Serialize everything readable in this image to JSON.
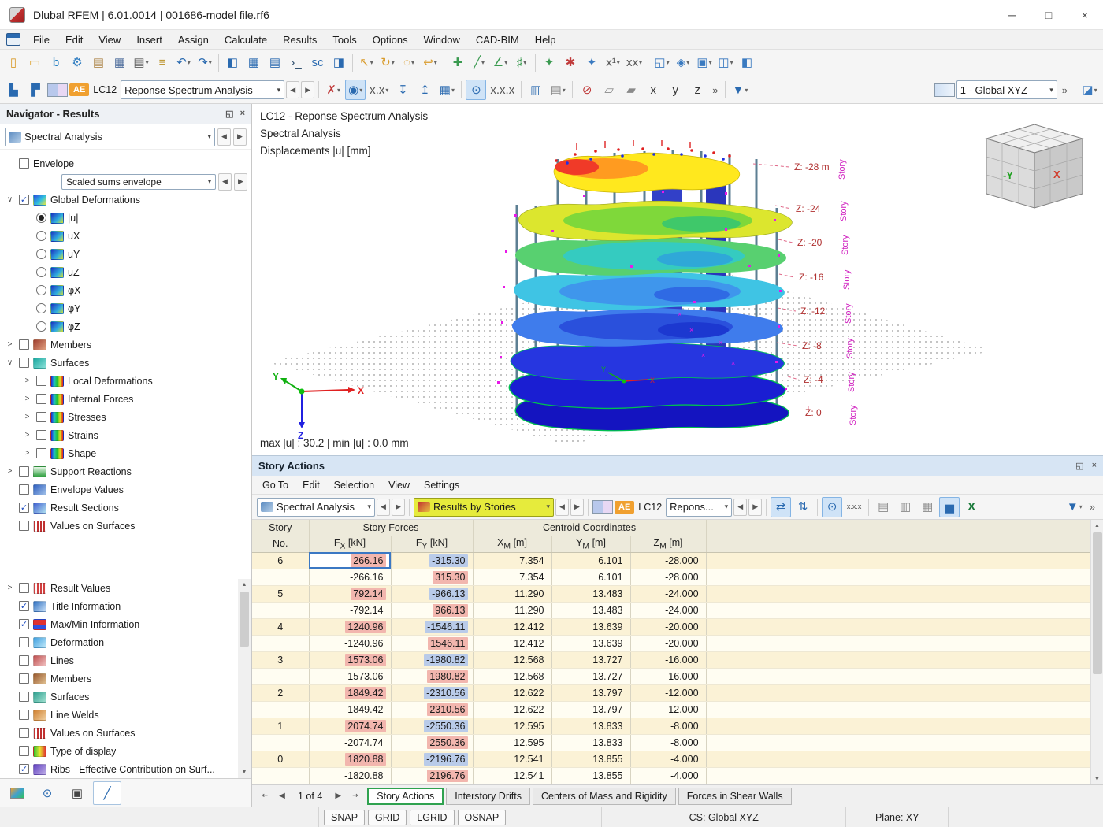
{
  "ui": {
    "dropdown": "▾",
    "left": "◀",
    "right": "▶",
    "chev_down": "∨",
    "chev_right": ">",
    "pin": "◱",
    "close": "×",
    "min": "─",
    "max": "□",
    "overflow": "»",
    "up": "▲",
    "down": "▼",
    "first": "⇤",
    "last": "⇥"
  },
  "window": {
    "title": "Dlubal RFEM | 6.01.0014 | 001686-model file.rf6"
  },
  "menu": {
    "items": [
      "File",
      "Edit",
      "View",
      "Insert",
      "Assign",
      "Calculate",
      "Results",
      "Tools",
      "Options",
      "Window",
      "CAD-BIM",
      "Help"
    ]
  },
  "toolbar1": {
    "icons": [
      {
        "name": "new-model-icon",
        "glyph": "▯",
        "color": "#d99b2b"
      },
      {
        "name": "open-file-icon",
        "glyph": "▭",
        "color": "#e0a83c"
      },
      {
        "name": "bim-link-icon",
        "glyph": "b",
        "color": "#1a7ac0"
      },
      {
        "name": "web-services-icon",
        "glyph": "⚙",
        "color": "#2a7ac0"
      },
      {
        "name": "paste-icon",
        "glyph": "▤",
        "color": "#b08a50"
      },
      {
        "name": "save-icon",
        "glyph": "▦",
        "color": "#4a6a9a"
      },
      {
        "name": "print-icon",
        "glyph": "▤",
        "color": "#5a5a5a",
        "dd": true
      },
      {
        "name": "printout-report-icon",
        "glyph": "≡",
        "color": "#c09a3a"
      },
      {
        "name": "undo-icon",
        "glyph": "↶",
        "color": "#2a6ab0",
        "dd": true
      },
      {
        "name": "redo-icon",
        "glyph": "↷",
        "color": "#2a6ab0",
        "dd": true
      },
      {
        "sep": true
      },
      {
        "name": "navigator-toggle-icon",
        "glyph": "◧",
        "color": "#2a6ab0"
      },
      {
        "name": "tables-toggle-icon",
        "glyph": "▦",
        "color": "#2a6ab0"
      },
      {
        "name": "report-icon",
        "glyph": "▤",
        "color": "#2a6ab0"
      },
      {
        "name": "script-console-icon",
        "glyph": "›_",
        "color": "#2a4a6a"
      },
      {
        "name": "to-scale-icon",
        "glyph": "sc",
        "color": "#2a6ab0"
      },
      {
        "name": "panels-icon",
        "glyph": "◨",
        "color": "#2a6ab0"
      },
      {
        "sep": true
      },
      {
        "name": "select-arrow-icon",
        "glyph": "↖",
        "color": "#d99b2b",
        "dd": true
      },
      {
        "name": "rotate-view-icon",
        "glyph": "↻",
        "color": "#d99b2b",
        "dd": true
      },
      {
        "name": "zoom-select-icon",
        "glyph": "◌",
        "color": "#d99b2b",
        "dd": true
      },
      {
        "name": "previous-view-icon",
        "glyph": "↩",
        "color": "#d99b2b",
        "dd": true
      },
      {
        "sep": true
      },
      {
        "name": "snap-node-icon",
        "glyph": "✚",
        "color": "#3a9a50"
      },
      {
        "name": "snap-line-icon",
        "glyph": "╱",
        "color": "#3a9a50",
        "dd": true
      },
      {
        "name": "snap-angle-icon",
        "glyph": "∠",
        "color": "#3a9a50",
        "dd": true
      },
      {
        "name": "guidelines-icon",
        "glyph": "♯",
        "color": "#3a9a50",
        "dd": true
      },
      {
        "sep": true
      },
      {
        "name": "generate-model-icon",
        "glyph": "✦",
        "color": "#3a9a50"
      },
      {
        "name": "generate-loads-icon",
        "glyph": "✱",
        "color": "#c03a3a"
      },
      {
        "name": "generate-combinations-icon",
        "glyph": "✦",
        "color": "#3a7ac0"
      },
      {
        "name": "numbering-icon",
        "glyph": "x¹",
        "color": "#555555",
        "dd": true
      },
      {
        "name": "renumber-icon",
        "glyph": "xx",
        "color": "#555555",
        "dd": true
      },
      {
        "sep": true
      },
      {
        "name": "new-window-icon",
        "glyph": "◱",
        "color": "#3a7ac0",
        "dd": true
      },
      {
        "name": "display-properties-icon",
        "glyph": "◈",
        "color": "#3a7ac0",
        "dd": true
      },
      {
        "name": "clipping-box-icon",
        "glyph": "▣",
        "color": "#3a7ac0",
        "dd": true
      },
      {
        "name": "visibility-icon",
        "glyph": "◫",
        "color": "#3a7ac0",
        "dd": true
      },
      {
        "name": "dock-panel-icon",
        "glyph": "◧",
        "color": "#3a7ac0"
      }
    ]
  },
  "toolbar2": {
    "ae_badge": "AE",
    "lc_label": "LC12",
    "combo_value": "Reponse Spectrum Analysis",
    "cs_combo": "1 - Global XYZ",
    "icons_a": [
      {
        "name": "loading-steps-icon",
        "glyph": "▙",
        "color": "#2a6ab0"
      },
      {
        "name": "load-increment-icon",
        "glyph": "▛",
        "color": "#2a6ab0"
      }
    ],
    "icons_b": [
      {
        "name": "delete-results-icon",
        "glyph": "✗",
        "color": "#c03a3a",
        "dd": true
      },
      {
        "name": "show-results-icon",
        "glyph": "◉",
        "color": "#2a6ab0",
        "dd": true,
        "active": true
      },
      {
        "name": "result-values-icon",
        "glyph": "x.x",
        "color": "#555555",
        "dd": true
      },
      {
        "name": "deformation-scale-down-icon",
        "glyph": "↧",
        "color": "#2a6ab0"
      },
      {
        "name": "deformation-scale-up-icon",
        "glyph": "↥",
        "color": "#2a6ab0"
      },
      {
        "name": "result-tables-icon",
        "glyph": "▦",
        "color": "#2a6ab0",
        "dd": true
      },
      {
        "sep": true
      },
      {
        "name": "show-values-eye-icon",
        "glyph": "⊙",
        "color": "#2a6ab0",
        "active": true
      },
      {
        "name": "values-xxx-icon",
        "glyph": "x.x.x",
        "color": "#555555"
      },
      {
        "sep": true
      },
      {
        "name": "section-icon",
        "glyph": "▥",
        "color": "#2a6ab0"
      },
      {
        "name": "measure-tables-icon",
        "glyph": "▤",
        "color": "#8a8a8a",
        "dd": true
      },
      {
        "sep": true
      },
      {
        "name": "clear-view-icon",
        "glyph": "⊘",
        "color": "#c03a3a"
      },
      {
        "name": "transparent-cube-icon",
        "glyph": "▱",
        "color": "#8a8a8a"
      },
      {
        "name": "solid-cube-icon",
        "glyph": "▰",
        "color": "#8a8a8a"
      },
      {
        "name": "axis-x-icon",
        "glyph": "x",
        "color": "#333333"
      },
      {
        "name": "axis-y-icon",
        "glyph": "y",
        "color": "#333333"
      },
      {
        "name": "axis-z-icon",
        "glyph": "z",
        "color": "#333333"
      }
    ],
    "icons_c": [
      {
        "name": "filter-icon",
        "glyph": "▼",
        "color": "#2a6ab0",
        "dd": true
      }
    ]
  },
  "navigator": {
    "title": "Navigator - Results",
    "combo": "Spectral Analysis",
    "tree_top": [
      {
        "t": "item",
        "label": "Envelope",
        "control": "checkbox",
        "checked": false,
        "chevron": "",
        "icon": "",
        "indent": 0
      },
      {
        "t": "combo",
        "value": "Scaled sums envelope"
      },
      {
        "t": "item",
        "label": "Global Deformations",
        "control": "checkbox",
        "checked": true,
        "chevron": "down",
        "icon": "global",
        "indent": 0
      },
      {
        "t": "item",
        "label": "|u|",
        "control": "radio",
        "checked": true,
        "chevron": "",
        "icon": "u",
        "indent": 1
      },
      {
        "t": "item",
        "label": "uX",
        "control": "radio",
        "checked": false,
        "chevron": "",
        "icon": "u",
        "indent": 1
      },
      {
        "t": "item",
        "label": "uY",
        "control": "radio",
        "checked": false,
        "chevron": "",
        "icon": "u",
        "indent": 1
      },
      {
        "t": "item",
        "label": "uZ",
        "control": "radio",
        "checked": false,
        "chevron": "",
        "icon": "u",
        "indent": 1
      },
      {
        "t": "item",
        "label": "φX",
        "control": "radio",
        "checked": false,
        "chevron": "",
        "icon": "u",
        "indent": 1
      },
      {
        "t": "item",
        "label": "φY",
        "control": "radio",
        "checked": false,
        "chevron": "",
        "icon": "u",
        "indent": 1
      },
      {
        "t": "item",
        "label": "φZ",
        "control": "radio",
        "checked": false,
        "chevron": "",
        "icon": "u",
        "indent": 1
      },
      {
        "t": "item",
        "label": "Members",
        "control": "checkbox",
        "checked": false,
        "chevron": "right",
        "icon": "members",
        "indent": 0
      },
      {
        "t": "item",
        "label": "Surfaces",
        "control": "checkbox",
        "checked": false,
        "chevron": "down",
        "icon": "surfaces",
        "indent": 0
      },
      {
        "t": "item",
        "label": "Local Deformations",
        "control": "checkbox",
        "checked": false,
        "chevron": "right",
        "icon": "rainbow",
        "indent": 1
      },
      {
        "t": "item",
        "label": "Internal Forces",
        "control": "checkbox",
        "checked": false,
        "chevron": "right",
        "icon": "rainbow",
        "indent": 1
      },
      {
        "t": "item",
        "label": "Stresses",
        "control": "checkbox",
        "checked": false,
        "chevron": "right",
        "icon": "rainbow",
        "indent": 1
      },
      {
        "t": "item",
        "label": "Strains",
        "control": "checkbox",
        "checked": false,
        "chevron": "right",
        "icon": "rainbow",
        "indent": 1
      },
      {
        "t": "item",
        "label": "Shape",
        "control": "checkbox",
        "checked": false,
        "chevron": "right",
        "icon": "rainbow",
        "indent": 1
      },
      {
        "t": "item",
        "label": "Support Reactions",
        "control": "checkbox",
        "checked": false,
        "chevron": "right",
        "icon": "support",
        "indent": 0
      },
      {
        "t": "item",
        "label": "Envelope Values",
        "control": "checkbox",
        "checked": false,
        "chevron": "",
        "icon": "envvals",
        "indent": 0
      },
      {
        "t": "item",
        "label": "Result Sections",
        "control": "checkbox",
        "checked": true,
        "chevron": "",
        "icon": "sections",
        "indent": 0
      },
      {
        "t": "item",
        "label": "Values on Surfaces",
        "control": "checkbox",
        "checked": false,
        "chevron": "",
        "icon": "xxx",
        "indent": 0
      }
    ],
    "tree_bottom": [
      {
        "t": "item",
        "label": "Result Values",
        "control": "checkbox",
        "checked": false,
        "chevron": "right",
        "icon": "xxxred",
        "indent": 0
      },
      {
        "t": "item",
        "label": "Title Information",
        "control": "checkbox",
        "checked": true,
        "chevron": "",
        "icon": "info",
        "indent": 0
      },
      {
        "t": "item",
        "label": "Max/Min Information",
        "control": "checkbox",
        "checked": true,
        "chevron": "",
        "icon": "maxmin",
        "indent": 0
      },
      {
        "t": "item",
        "label": "Deformation",
        "control": "checkbox",
        "checked": false,
        "chevron": "",
        "icon": "deform",
        "indent": 0
      },
      {
        "t": "item",
        "label": "Lines",
        "control": "checkbox",
        "checked": false,
        "chevron": "",
        "icon": "lines",
        "indent": 0
      },
      {
        "t": "item",
        "label": "Members",
        "control": "checkbox",
        "checked": false,
        "chevron": "",
        "icon": "members2",
        "indent": 0
      },
      {
        "t": "item",
        "label": "Surfaces",
        "control": "checkbox",
        "checked": false,
        "chevron": "",
        "icon": "surfaces2",
        "indent": 0
      },
      {
        "t": "item",
        "label": "Line Welds",
        "control": "checkbox",
        "checked": false,
        "chevron": "",
        "icon": "welds",
        "indent": 0
      },
      {
        "t": "item",
        "label": "Values on Surfaces",
        "control": "checkbox",
        "checked": false,
        "chevron": "",
        "icon": "xxx",
        "indent": 0
      },
      {
        "t": "item",
        "label": "Type of display",
        "control": "checkbox",
        "checked": false,
        "chevron": "",
        "icon": "typedisp",
        "indent": 0
      },
      {
        "t": "item",
        "label": "Ribs - Effective Contribution on Surf...",
        "control": "checkbox",
        "checked": true,
        "chevron": "",
        "icon": "ribs",
        "indent": 0
      }
    ]
  },
  "viewport": {
    "line1": "LC12 - Reponse Spectrum Analysis",
    "line2": "Spectral Analysis",
    "line3": "Displacements |u| [mm]",
    "maxmin": "max |u| : 30.2 | min |u| : 0.0 mm",
    "story_labels": [
      "Z: -28 m",
      "Z: -24",
      "Z: -20",
      "Z: -16",
      "Z: -12",
      "Z: -8",
      "Z: -4",
      "Z: 0"
    ],
    "story_text": "Story",
    "axis": {
      "x": "X",
      "y": "Y",
      "z": "Z"
    },
    "cube": {
      "front": "-Y",
      "right": "X"
    }
  },
  "story_panel": {
    "title": "Story Actions",
    "menu": [
      "Go To",
      "Edit",
      "Selection",
      "View",
      "Settings"
    ],
    "combo1": "Spectral Analysis",
    "combo2": "Results by Stories",
    "ae_badge": "AE",
    "lc_label": "LC12",
    "combo3": "Repons...",
    "table": {
      "g1": "Story",
      "g2": "Story Forces",
      "g3": "Centroid Coordinates",
      "cols": [
        {
          "t": "No.",
          "s": "",
          "u": ""
        },
        {
          "t": "F",
          "s": "X",
          "u": "[kN]"
        },
        {
          "t": "F",
          "s": "Y",
          "u": "[kN]"
        },
        {
          "t": "X",
          "s": "M",
          "u": "[m]"
        },
        {
          "t": "Y",
          "s": "M",
          "u": "[m]"
        },
        {
          "t": "Z",
          "s": "M",
          "u": "[m]"
        }
      ],
      "rows": [
        {
          "story": "6",
          "fx": "266.16",
          "fy": "-315.30",
          "xm": "7.354",
          "ym": "6.101",
          "zm": "-28.000",
          "fxh": "pink",
          "fyh": "blue",
          "sel": true
        },
        {
          "story": "",
          "fx": "-266.16",
          "fy": "315.30",
          "xm": "7.354",
          "ym": "6.101",
          "zm": "-28.000",
          "fxh": "",
          "fyh": "pink",
          "sel": false
        },
        {
          "story": "5",
          "fx": "792.14",
          "fy": "-966.13",
          "xm": "11.290",
          "ym": "13.483",
          "zm": "-24.000",
          "fxh": "pink",
          "fyh": "blue",
          "sel": false
        },
        {
          "story": "",
          "fx": "-792.14",
          "fy": "966.13",
          "xm": "11.290",
          "ym": "13.483",
          "zm": "-24.000",
          "fxh": "",
          "fyh": "pink",
          "sel": false
        },
        {
          "story": "4",
          "fx": "1240.96",
          "fy": "-1546.11",
          "xm": "12.412",
          "ym": "13.639",
          "zm": "-20.000",
          "fxh": "pink",
          "fyh": "blue",
          "sel": false
        },
        {
          "story": "",
          "fx": "-1240.96",
          "fy": "1546.11",
          "xm": "12.412",
          "ym": "13.639",
          "zm": "-20.000",
          "fxh": "",
          "fyh": "pink",
          "sel": false
        },
        {
          "story": "3",
          "fx": "1573.06",
          "fy": "-1980.82",
          "xm": "12.568",
          "ym": "13.727",
          "zm": "-16.000",
          "fxh": "pink",
          "fyh": "blue",
          "sel": false
        },
        {
          "story": "",
          "fx": "-1573.06",
          "fy": "1980.82",
          "xm": "12.568",
          "ym": "13.727",
          "zm": "-16.000",
          "fxh": "",
          "fyh": "pink",
          "sel": false
        },
        {
          "story": "2",
          "fx": "1849.42",
          "fy": "-2310.56",
          "xm": "12.622",
          "ym": "13.797",
          "zm": "-12.000",
          "fxh": "pink",
          "fyh": "blue",
          "sel": false
        },
        {
          "story": "",
          "fx": "-1849.42",
          "fy": "2310.56",
          "xm": "12.622",
          "ym": "13.797",
          "zm": "-12.000",
          "fxh": "",
          "fyh": "pink",
          "sel": false
        },
        {
          "story": "1",
          "fx": "2074.74",
          "fy": "-2550.36",
          "xm": "12.595",
          "ym": "13.833",
          "zm": "-8.000",
          "fxh": "pink",
          "fyh": "blue",
          "sel": false
        },
        {
          "story": "",
          "fx": "-2074.74",
          "fy": "2550.36",
          "xm": "12.595",
          "ym": "13.833",
          "zm": "-8.000",
          "fxh": "",
          "fyh": "pink",
          "sel": false
        },
        {
          "story": "0",
          "fx": "1820.88",
          "fy": "-2196.76",
          "xm": "12.541",
          "ym": "13.855",
          "zm": "-4.000",
          "fxh": "pink",
          "fyh": "blue",
          "sel": false
        },
        {
          "story": "",
          "fx": "-1820.88",
          "fy": "2196.76",
          "xm": "12.541",
          "ym": "13.855",
          "zm": "-4.000",
          "fxh": "",
          "fyh": "pink",
          "sel": false
        }
      ]
    },
    "pager": "1 of 4",
    "tabs": [
      "Story Actions",
      "Interstory Drifts",
      "Centers of Mass and Rigidity",
      "Forces in Shear Walls"
    ],
    "active_tab": 0
  },
  "statusbar": {
    "buttons": [
      "SNAP",
      "GRID",
      "LGRID",
      "OSNAP"
    ],
    "cs": "CS: Global XYZ",
    "plane": "Plane: XY"
  }
}
